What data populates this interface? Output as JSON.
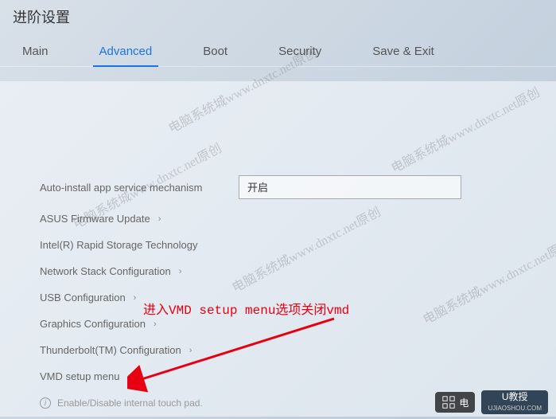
{
  "title": "进阶设置",
  "tabs": {
    "main": "Main",
    "advanced": "Advanced",
    "boot": "Boot",
    "security": "Security",
    "save_exit": "Save & Exit"
  },
  "settings": {
    "auto_service": {
      "label": "Auto-install app service mechanism",
      "value": "开启"
    },
    "asus_firmware": "ASUS Firmware Update",
    "intel_rst": "Intel(R) Rapid Storage Technology",
    "network_stack": "Network Stack Configuration",
    "usb_config": "USB Configuration",
    "graphics_config": "Graphics Configuration",
    "thunderbolt": "Thunderbolt(TM) Configuration",
    "vmd": "VMD setup menu"
  },
  "info_text": "Enable/Disable internal touch pad.",
  "annotation": "进入VMD setup menu选项关闭vmd",
  "watermark": "电脑系统城www.dnxtc.net原创",
  "logos": {
    "l1": "电",
    "l2_main": "U教授",
    "l2_sub": "UJIAOSHOU.COM"
  }
}
